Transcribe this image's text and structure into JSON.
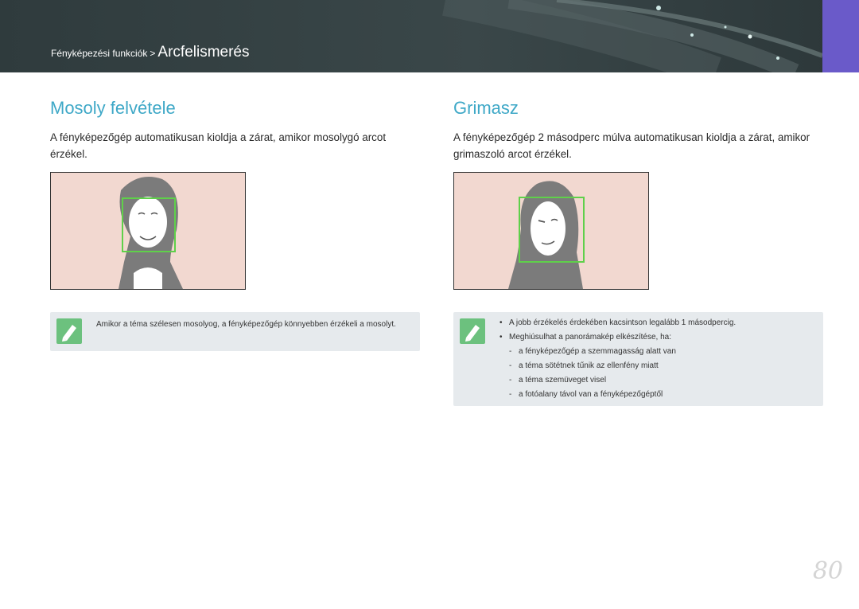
{
  "header": {
    "breadcrumb_parent": "Fényképezési funkciók",
    "breadcrumb_separator": ">",
    "breadcrumb_current": "Arcfelismerés",
    "accent_color": "#6a5ac9"
  },
  "left": {
    "title": "Mosoly felvétele",
    "text": "A fényképezőgép automatikusan kioldja a zárat, amikor mosolygó arcot érzékel.",
    "note": "Amikor a téma szélesen mosolyog, a fényképezőgép könnyebben érzékeli a mosolyt.",
    "note_icon": "pencil-note-icon"
  },
  "right": {
    "title": "Grimasz",
    "text": "A fényképezőgép 2 másodperc múlva automatikusan kioldja a zárat, amikor grimaszoló arcot érzékel.",
    "note_icon": "pencil-note-icon",
    "notes": [
      "A jobb érzékelés érdekében kacsintson legalább 1 másodpercig.",
      "Meghiúsulhat a panorámakép elkészítése, ha:"
    ],
    "sub_notes": [
      "a fényképezőgép a szemmagasság alatt van",
      "a téma sötétnek tűnik az ellenfény miatt",
      "a téma szemüveget visel",
      "a fotóalany távol van a fényképezőgéptől"
    ]
  },
  "colors": {
    "title": "#3ea8c7",
    "face_frame": "#5fd04a",
    "photo_bg": "#f2d8d0"
  },
  "page_number": "80"
}
